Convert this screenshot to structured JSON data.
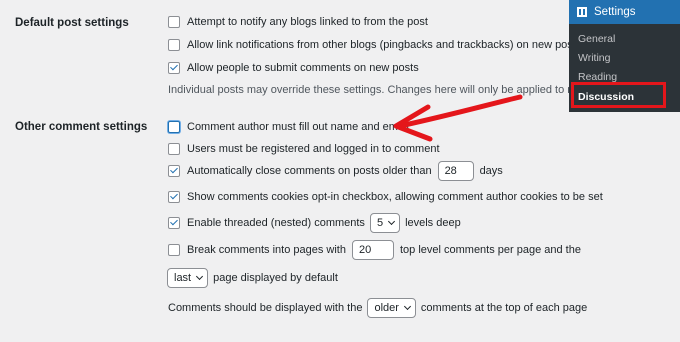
{
  "sections": {
    "default_post": "Default post settings",
    "other_comment": "Other comment settings"
  },
  "default_post": {
    "notify_blogs": "Attempt to notify any blogs linked to from the post",
    "allow_pings": "Allow link notifications from other blogs (pingbacks and trackbacks) on new posts",
    "allow_comments": "Allow people to submit comments on new posts",
    "note": "Individual posts may override these settings. Changes here will only be applied to new posts."
  },
  "other_comment": {
    "require_name_email": "Comment author must fill out name and email",
    "registration_required": "Users must be registered and logged in to comment",
    "close_prefix": "Automatically close comments on posts older than",
    "close_days": "28",
    "close_suffix": "days",
    "cookies_optin": "Show comments cookies opt-in checkbox, allowing comment author cookies to be set",
    "threaded_prefix": "Enable threaded (nested) comments",
    "thread_depth": "5",
    "threaded_suffix": "levels deep",
    "paged_prefix": "Break comments into pages with",
    "per_page": "20",
    "paged_suffix": "top level comments per page and the",
    "default_page": "last",
    "default_page_suffix": "page displayed by default",
    "order_prefix": "Comments should be displayed with the",
    "order": "older",
    "order_suffix": "comments at the top of each page"
  },
  "checks": {
    "notify_blogs": false,
    "allow_pings": false,
    "allow_comments": true,
    "require_name_email": false,
    "registration_required": false,
    "close_comments": true,
    "cookies_optin": true,
    "threaded": true,
    "paged": false
  },
  "menu": {
    "title": "Settings",
    "items": [
      "General",
      "Writing",
      "Reading",
      "Discussion"
    ],
    "current": "Discussion",
    "icon": "settings-icon"
  },
  "colors": {
    "accent": "#2271b1",
    "annotation_red": "#e4161b",
    "menu_bg": "#2c3338",
    "page_bg": "#f0f0f1"
  }
}
